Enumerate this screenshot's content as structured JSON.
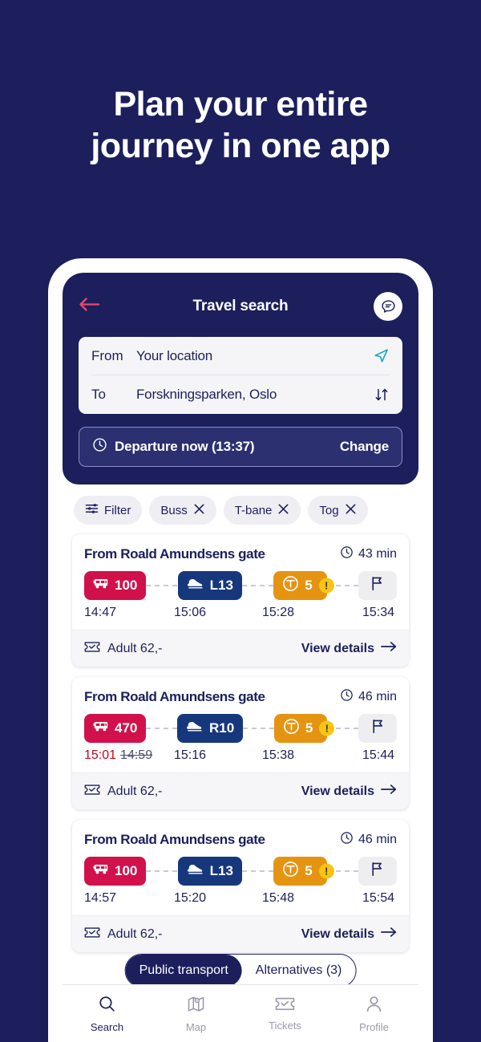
{
  "headline": {
    "line1": "Plan your entire",
    "line2": "journey in one app"
  },
  "colors": {
    "page_background": "#1C1F5C",
    "bus_badge": "#D1114B",
    "train_badge": "#17377D",
    "metro_badge": "#E59412",
    "warning_badge": "#F5C518",
    "delay_text": "#D0021B",
    "accent_back_arrow": "#E8486B"
  },
  "header": {
    "back_icon": "arrow-left-icon",
    "title": "Travel search",
    "chat_icon": "chat-bubble-icon"
  },
  "search": {
    "from_label": "From",
    "from_value": "Your location",
    "from_icon": "location-arrow-icon",
    "to_label": "To",
    "to_value": "Forskningsparken, Oslo",
    "swap_icon": "swap-vertical-icon"
  },
  "departure": {
    "clock_icon": "clock-icon",
    "text": "Departure now (13:37)",
    "change_label": "Change"
  },
  "filters": [
    {
      "label": "Filter",
      "icon": "sliders-icon",
      "removable": false
    },
    {
      "label": "Buss",
      "icon": "close-icon",
      "removable": true
    },
    {
      "label": "T-bane",
      "icon": "close-icon",
      "removable": true
    },
    {
      "label": "Tog",
      "icon": "close-icon",
      "removable": true
    }
  ],
  "results": [
    {
      "title": "From Roald Amundsens gate",
      "duration": "43 min",
      "duration_icon": "clock-icon",
      "legs": [
        {
          "type": "bus",
          "icon": "bus-icon",
          "line": "100",
          "time": "14:47",
          "delayed_time": "",
          "warning": false
        },
        {
          "type": "train",
          "icon": "train-icon",
          "line": "L13",
          "time": "15:06",
          "delayed_time": "",
          "warning": false
        },
        {
          "type": "metro",
          "icon": "metro-t-icon",
          "line": "5",
          "time": "15:28",
          "delayed_time": "",
          "warning": true
        },
        {
          "type": "dest",
          "icon": "flag-icon",
          "line": "",
          "time": "15:34",
          "delayed_time": "",
          "warning": false
        }
      ],
      "price_icon": "ticket-icon",
      "price": "Adult 62,-",
      "details_label": "View details",
      "details_icon": "arrow-right-icon"
    },
    {
      "title": "From Roald Amundsens gate",
      "duration": "46 min",
      "duration_icon": "clock-icon",
      "legs": [
        {
          "type": "bus",
          "icon": "bus-icon",
          "line": "470",
          "time": "15:01",
          "delayed_time": "14:59",
          "warning": false
        },
        {
          "type": "train",
          "icon": "train-icon",
          "line": "R10",
          "time": "15:16",
          "delayed_time": "",
          "warning": false
        },
        {
          "type": "metro",
          "icon": "metro-t-icon",
          "line": "5",
          "time": "15:38",
          "delayed_time": "",
          "warning": true
        },
        {
          "type": "dest",
          "icon": "flag-icon",
          "line": "",
          "time": "15:44",
          "delayed_time": "",
          "warning": false
        }
      ],
      "price_icon": "ticket-icon",
      "price": "Adult 62,-",
      "details_label": "View details",
      "details_icon": "arrow-right-icon"
    },
    {
      "title": "From Roald Amundsens gate",
      "duration": "46 min",
      "duration_icon": "clock-icon",
      "legs": [
        {
          "type": "bus",
          "icon": "bus-icon",
          "line": "100",
          "time": "14:57",
          "delayed_time": "",
          "warning": false
        },
        {
          "type": "train",
          "icon": "train-icon",
          "line": "L13",
          "time": "15:20",
          "delayed_time": "",
          "warning": false
        },
        {
          "type": "metro",
          "icon": "metro-t-icon",
          "line": "5",
          "time": "15:48",
          "delayed_time": "",
          "warning": true
        },
        {
          "type": "dest",
          "icon": "flag-icon",
          "line": "",
          "time": "15:54",
          "delayed_time": "",
          "warning": false
        }
      ],
      "price_icon": "ticket-icon",
      "price": "Adult 62,-",
      "details_label": "View details",
      "details_icon": "arrow-right-icon"
    }
  ],
  "segmented": {
    "active_label": "Public transport",
    "inactive_label": "Alternatives (3)"
  },
  "bottom_nav": [
    {
      "label": "Search",
      "icon": "search-icon",
      "active": true
    },
    {
      "label": "Map",
      "icon": "map-icon",
      "active": false
    },
    {
      "label": "Tickets",
      "icon": "ticket-icon",
      "active": false
    },
    {
      "label": "Profile",
      "icon": "person-icon",
      "active": false
    }
  ]
}
